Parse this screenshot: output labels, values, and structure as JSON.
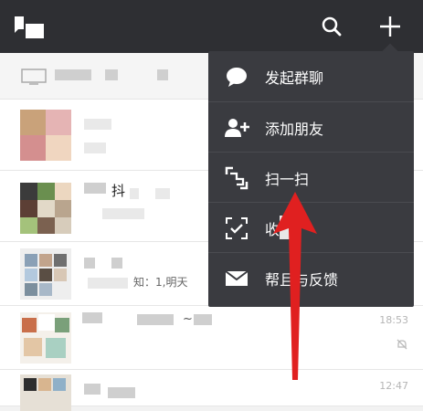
{
  "header": {
    "logo_icon": "chat-bubble-logo-icon",
    "search_icon": "search-icon",
    "add_icon": "plus-icon"
  },
  "menu": {
    "items": [
      {
        "label": "发起群聊",
        "icon": "chat-bubble-icon"
      },
      {
        "label": "添加朋友",
        "icon": "add-person-icon"
      },
      {
        "label": "扫一扫",
        "icon": "scan-icon"
      },
      {
        "label": "收",
        "icon": "money-scan-icon"
      },
      {
        "label": "帮且与反馈",
        "icon": "mail-icon"
      }
    ]
  },
  "chats": [
    {
      "preview": "",
      "time": ""
    },
    {
      "preview": "",
      "time": ""
    },
    {
      "preview": "抖",
      "time": ""
    },
    {
      "preview": "知：1,明天",
      "time": ""
    },
    {
      "preview": "~",
      "time": "18:53"
    },
    {
      "preview": "",
      "time": "12:47"
    }
  ],
  "colors": {
    "header_bg": "#2e2f33",
    "menu_bg": "#3a3b40",
    "annotation_arrow": "#e02020"
  }
}
